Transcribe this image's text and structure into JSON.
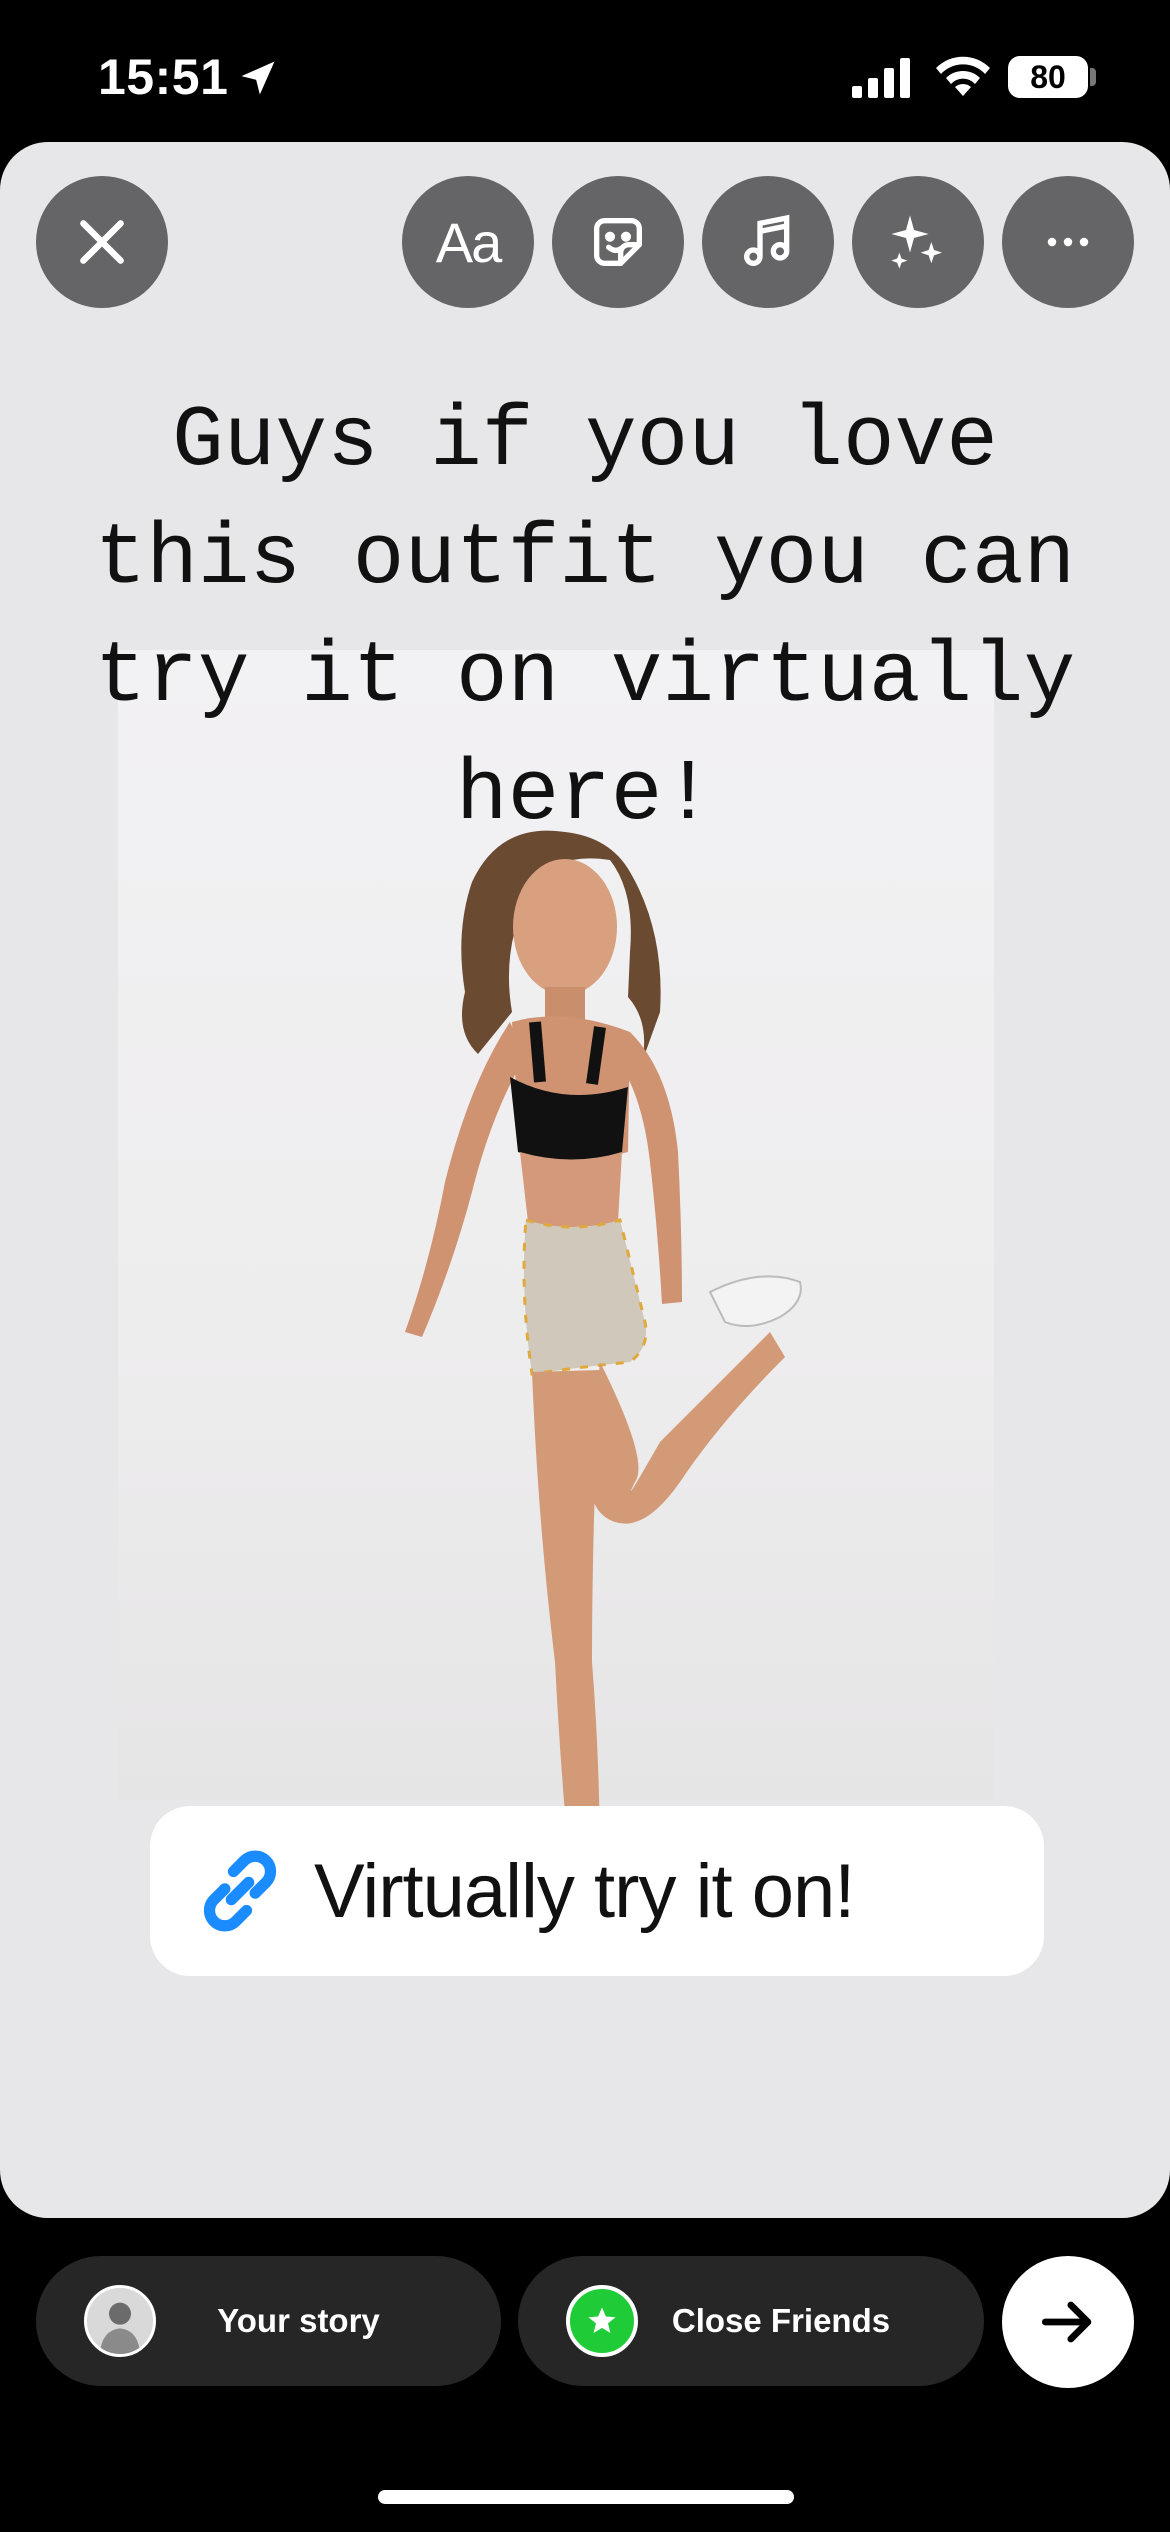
{
  "status_bar": {
    "time": "15:51",
    "battery": "80",
    "icons": [
      "location-arrow-icon",
      "cellular-signal-icon",
      "wifi-icon",
      "battery-icon"
    ]
  },
  "toolbar": {
    "close_icon": "close-icon",
    "text_tool_label": "Aa",
    "sticker_icon": "sticker-icon",
    "music_icon": "music-icon",
    "effects_icon": "sparkles-icon",
    "more_icon": "more-icon"
  },
  "story": {
    "caption": "Guys if you love this outfit you can try it on virtually here!",
    "photo": "woman in black sports bra and bee-print shorts stretching",
    "link_sticker": {
      "icon": "link-icon",
      "label": "Virtually try it on!",
      "accent": "#1a8cff"
    }
  },
  "share_bar": {
    "your_story_label": "Your story",
    "close_friends_label": "Close Friends",
    "close_friends_color": "#1fcc38",
    "next_icon": "arrow-right-icon"
  }
}
